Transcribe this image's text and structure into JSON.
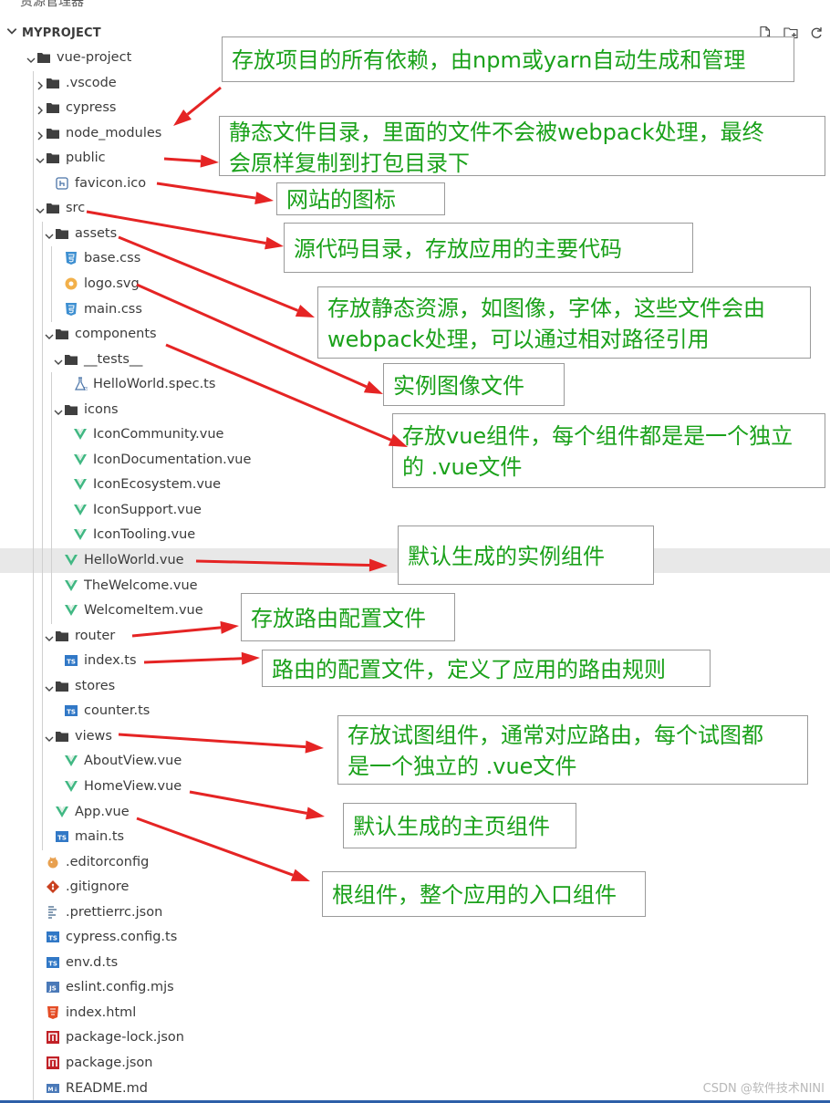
{
  "panel": {
    "top_title": "资源管理器",
    "project_name": "MYPROJECT",
    "actions": [
      "new-file-icon",
      "new-folder-icon",
      "refresh-icon"
    ]
  },
  "tree": [
    {
      "label": "vue-project",
      "kind": "folder",
      "depth": 0,
      "open": true
    },
    {
      "label": ".vscode",
      "kind": "folder",
      "depth": 1,
      "open": false
    },
    {
      "label": "cypress",
      "kind": "folder",
      "depth": 1,
      "open": false
    },
    {
      "label": "node_modules",
      "kind": "folder",
      "depth": 1,
      "open": false,
      "icon": "node"
    },
    {
      "label": "public",
      "kind": "folder",
      "depth": 1,
      "open": true
    },
    {
      "label": "favicon.ico",
      "kind": "file",
      "depth": 2,
      "icon": "ico"
    },
    {
      "label": "src",
      "kind": "folder",
      "depth": 1,
      "open": true
    },
    {
      "label": "assets",
      "kind": "folder",
      "depth": 2,
      "open": true
    },
    {
      "label": "base.css",
      "kind": "file",
      "depth": 3,
      "icon": "css"
    },
    {
      "label": "logo.svg",
      "kind": "file",
      "depth": 3,
      "icon": "svg"
    },
    {
      "label": "main.css",
      "kind": "file",
      "depth": 3,
      "icon": "css"
    },
    {
      "label": "components",
      "kind": "folder",
      "depth": 2,
      "open": true
    },
    {
      "label": "__tests__",
      "kind": "folder",
      "depth": 3,
      "open": true
    },
    {
      "label": "HelloWorld.spec.ts",
      "kind": "file",
      "depth": 4,
      "icon": "test"
    },
    {
      "label": "icons",
      "kind": "folder",
      "depth": 3,
      "open": true
    },
    {
      "label": "IconCommunity.vue",
      "kind": "file",
      "depth": 4,
      "icon": "vue"
    },
    {
      "label": "IconDocumentation.vue",
      "kind": "file",
      "depth": 4,
      "icon": "vue"
    },
    {
      "label": "IconEcosystem.vue",
      "kind": "file",
      "depth": 4,
      "icon": "vue"
    },
    {
      "label": "IconSupport.vue",
      "kind": "file",
      "depth": 4,
      "icon": "vue"
    },
    {
      "label": "IconTooling.vue",
      "kind": "file",
      "depth": 4,
      "icon": "vue"
    },
    {
      "label": "HelloWorld.vue",
      "kind": "file",
      "depth": 3,
      "icon": "vue",
      "selected": true
    },
    {
      "label": "TheWelcome.vue",
      "kind": "file",
      "depth": 3,
      "icon": "vue"
    },
    {
      "label": "WelcomeItem.vue",
      "kind": "file",
      "depth": 3,
      "icon": "vue"
    },
    {
      "label": "router",
      "kind": "folder",
      "depth": 2,
      "open": true
    },
    {
      "label": "index.ts",
      "kind": "file",
      "depth": 3,
      "icon": "ts"
    },
    {
      "label": "stores",
      "kind": "folder",
      "depth": 2,
      "open": true
    },
    {
      "label": "counter.ts",
      "kind": "file",
      "depth": 3,
      "icon": "ts"
    },
    {
      "label": "views",
      "kind": "folder",
      "depth": 2,
      "open": true
    },
    {
      "label": "AboutView.vue",
      "kind": "file",
      "depth": 3,
      "icon": "vue"
    },
    {
      "label": "HomeView.vue",
      "kind": "file",
      "depth": 3,
      "icon": "vue"
    },
    {
      "label": "App.vue",
      "kind": "file",
      "depth": 2,
      "icon": "vue"
    },
    {
      "label": "main.ts",
      "kind": "file",
      "depth": 2,
      "icon": "ts"
    },
    {
      "label": ".editorconfig",
      "kind": "file",
      "depth": 1,
      "icon": "editorconfig"
    },
    {
      "label": ".gitignore",
      "kind": "file",
      "depth": 1,
      "icon": "git"
    },
    {
      "label": ".prettierrc.json",
      "kind": "file",
      "depth": 1,
      "icon": "prettier"
    },
    {
      "label": "cypress.config.ts",
      "kind": "file",
      "depth": 1,
      "icon": "ts"
    },
    {
      "label": "env.d.ts",
      "kind": "file",
      "depth": 1,
      "icon": "ts"
    },
    {
      "label": "eslint.config.mjs",
      "kind": "file",
      "depth": 1,
      "icon": "js"
    },
    {
      "label": "index.html",
      "kind": "file",
      "depth": 1,
      "icon": "html"
    },
    {
      "label": "package-lock.json",
      "kind": "file",
      "depth": 1,
      "icon": "npm"
    },
    {
      "label": "package.json",
      "kind": "file",
      "depth": 1,
      "icon": "npm"
    },
    {
      "label": "README.md",
      "kind": "file",
      "depth": 1,
      "icon": "md"
    }
  ],
  "callouts": [
    {
      "text": "存放项目的所有依赖，由npm或yarn自动生成和管理"
    },
    {
      "text": "静态文件目录，里面的文件不会被webpack处理，最终\n会原样复制到打包目录下"
    },
    {
      "text": "网站的图标"
    },
    {
      "text": "源代码目录，存放应用的主要代码"
    },
    {
      "text": "存放静态资源，如图像，字体，这些文件会由\nwebpack处理，可以通过相对路径引用"
    },
    {
      "text": "实例图像文件"
    },
    {
      "text": "存放vue组件，每个组件都是是一个独立\n的  .vue文件"
    },
    {
      "text": "默认生成的实例组件"
    },
    {
      "text": "存放路由配置文件"
    },
    {
      "text": "路由的配置文件，定义了应用的路由规则"
    },
    {
      "text": "存放试图组件，通常对应路由，每个试图都\n是一个独立的  .vue文件"
    },
    {
      "text": "默认生成的主页组件"
    },
    {
      "text": "根组件，整个应用的入口组件"
    }
  ],
  "watermark": "CSDN @软件技术NINI",
  "colors": {
    "callout_text": "#1aa11a",
    "arrow": "#e52424",
    "selected_row": "#e8e8e8",
    "vue": "#41b883",
    "ts": "#3178c6",
    "css": "#3d8fd1",
    "npm": "#c12127",
    "html": "#e44d26"
  }
}
